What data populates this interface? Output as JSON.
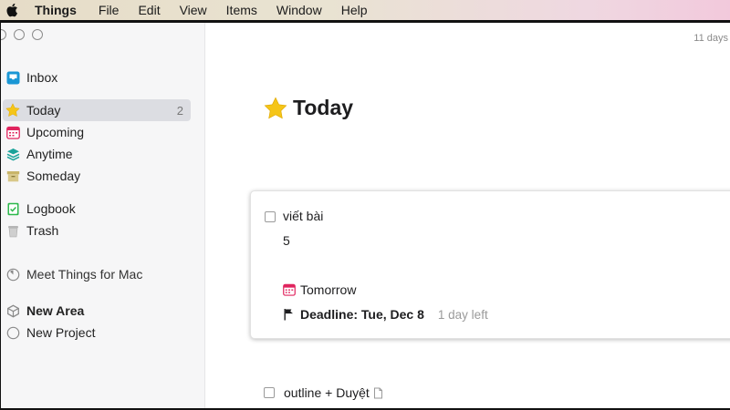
{
  "menubar": {
    "app_name": "Things",
    "items": [
      "File",
      "Edit",
      "View",
      "Items",
      "Window",
      "Help"
    ]
  },
  "sidebar": {
    "items": [
      {
        "label": "Inbox",
        "icon": "inbox-icon"
      },
      {
        "label": "Today",
        "icon": "star-icon",
        "count": "2",
        "selected": true
      },
      {
        "label": "Upcoming",
        "icon": "calendar-icon"
      },
      {
        "label": "Anytime",
        "icon": "layers-icon"
      },
      {
        "label": "Someday",
        "icon": "archive-box-icon"
      },
      {
        "label": "Logbook",
        "icon": "logbook-icon"
      },
      {
        "label": "Trash",
        "icon": "trash-icon"
      },
      {
        "label": "Meet Things for Mac",
        "icon": "progress-circle-icon"
      },
      {
        "label": "New Area",
        "icon": "area-cube-icon"
      },
      {
        "label": "New Project",
        "icon": "project-circle-icon"
      }
    ]
  },
  "main": {
    "top_right_label": "11 days",
    "title": "Today",
    "tasks": [
      {
        "title": "viết bài",
        "notes": "5",
        "when": "Tomorrow",
        "deadline": "Deadline: Tue, Dec 8",
        "deadline_remaining": "1 day left"
      },
      {
        "title": "outline + Duyệt"
      }
    ]
  },
  "colors": {
    "inbox": "#1a97d5",
    "star": "#f5c518",
    "upcoming": "#e0245e",
    "anytime": "#1aa39a",
    "someday": "#c9b56a",
    "logbook": "#2db84c",
    "trash": "#a7a7a7",
    "selected_bg": "#dcdde2"
  }
}
